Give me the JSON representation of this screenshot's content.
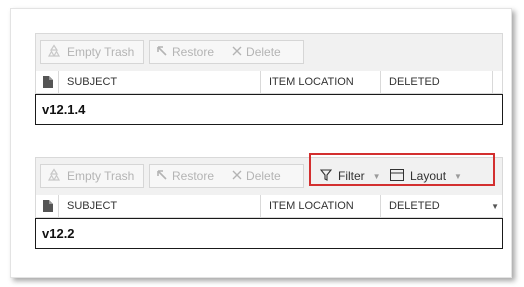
{
  "toolbar_labels": {
    "empty_trash": "Empty Trash",
    "restore": "Restore",
    "delete": "Delete",
    "filter": "Filter",
    "layout": "Layout"
  },
  "columns": {
    "subject": "SUBJECT",
    "item_location": "ITEM LOCATION",
    "deleted": "DELETED"
  },
  "panels": [
    {
      "version": "v12.1.4"
    },
    {
      "version": "v12.2"
    }
  ],
  "colors": {
    "highlight": "#d32f2f",
    "disabled_text": "#b4b4b4",
    "toolbar_bg": "#f1f1f1"
  },
  "icons": [
    "recycle-icon",
    "restore-arrow-icon",
    "x-icon",
    "funnel-icon",
    "layout-icon",
    "document-icon",
    "caret-down-icon"
  ]
}
